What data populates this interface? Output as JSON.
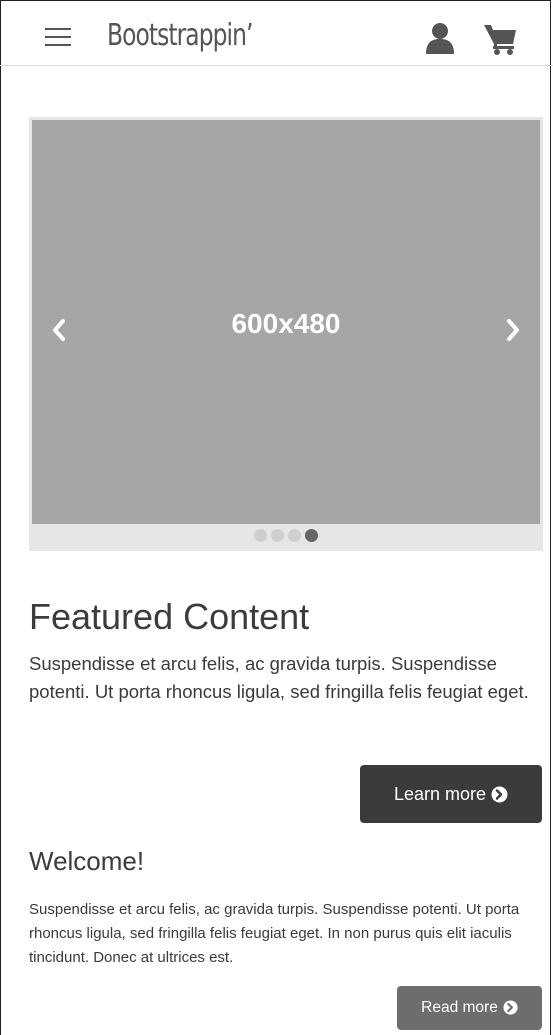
{
  "navbar": {
    "brand": "Bootstrappin’",
    "menu_icon": "hamburger-menu-icon",
    "user_icon": "user-icon",
    "cart_icon": "shopping-cart-icon"
  },
  "carousel": {
    "slide_label": "600x480",
    "prev_icon": "chevron-left-icon",
    "next_icon": "chevron-right-icon",
    "slide_count": 4,
    "active_index": 3
  },
  "featured": {
    "title": "Featured Content",
    "text": "Suspendisse et arcu felis, ac gravida turpis. Suspendisse potenti. Ut porta rhoncus ligula, sed fringilla felis feugiat eget.",
    "button_label": "Learn more",
    "button_icon": "circle-arrow-right-icon"
  },
  "welcome": {
    "title": "Welcome!",
    "text": "Suspendisse et arcu felis, ac gravida turpis. Suspendisse potenti. Ut porta rhoncus ligula, sed fringilla felis feugiat eget. In non purus quis elit iaculis tincidunt. Donec at ultrices est.",
    "button_label": "Read more",
    "button_icon": "circle-arrow-right-icon"
  },
  "colors": {
    "text": "#3a3a3a",
    "slide": "#a6a6a6",
    "learn_button": "#3b3b3b",
    "read_button": "#6d6d6d"
  }
}
